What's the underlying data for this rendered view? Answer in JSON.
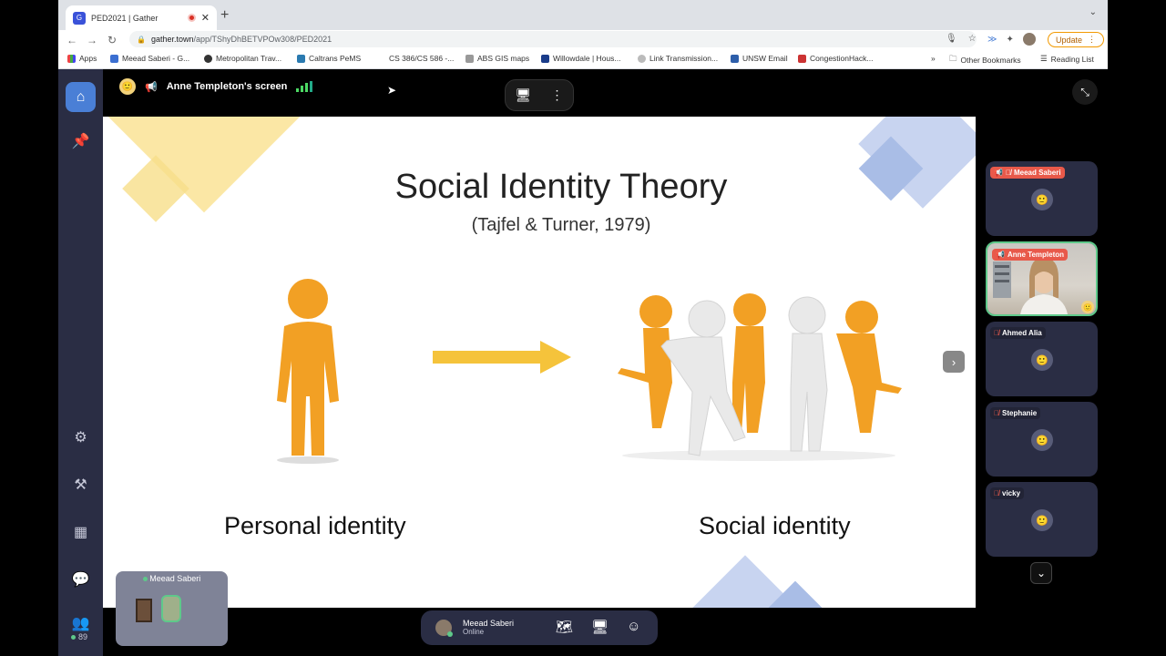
{
  "browser": {
    "tab_title": "PED2021 | Gather",
    "url_host": "gather.town",
    "url_path": "/app/TShyDhBETVPOw308/PED2021",
    "update_label": "Update",
    "bookmarks": [
      "Apps",
      "Meead Saberi - G...",
      "Metropolitan Trav...",
      "Caltrans PeMS",
      "CS 386/CS 586 -...",
      "ABS GIS maps",
      "Willowdale | Hous...",
      "Link Transmission...",
      "UNSW Email",
      "CongestionHack...",
      "»",
      "Other Bookmarks",
      "Reading List"
    ]
  },
  "gather": {
    "screen_share_title": "Anne Templeton's screen",
    "online_count": "89",
    "participants": [
      {
        "name": "Meead Saberi",
        "muted": true,
        "speaking": false
      },
      {
        "name": "Anne Templeton",
        "muted": false,
        "speaking": true
      },
      {
        "name": "Ahmed Alia",
        "muted": true,
        "speaking": false
      },
      {
        "name": "Stephanie",
        "muted": true,
        "speaking": false
      },
      {
        "name": "vicky",
        "muted": true,
        "speaking": false
      }
    ],
    "minimap_label": "Meead Saberi",
    "me": {
      "name": "Meead Saberi",
      "status": "Online"
    }
  },
  "slide": {
    "title": "Social Identity Theory",
    "subtitle": "(Tajfel & Turner, 1979)",
    "left_label": "Personal identity",
    "right_label": "Social identity"
  },
  "colors": {
    "accent_blue": "#4a7fd6",
    "speaking_green": "#5ec98a",
    "muted_red": "#e8594a",
    "deco_yellow": "#f8de8a",
    "deco_blue": "#b8c7ea",
    "figure_orange": "#f2a024",
    "arrow_yellow": "#f5c33b"
  }
}
